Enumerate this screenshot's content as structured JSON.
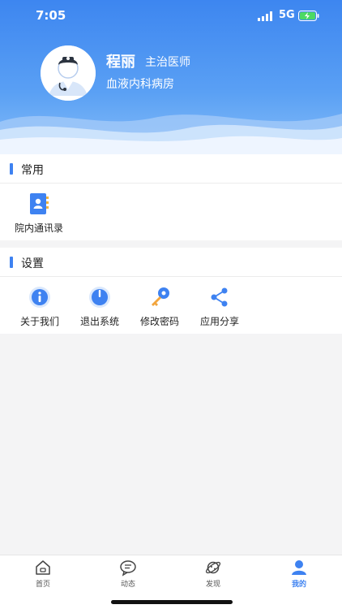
{
  "status_bar": {
    "time": "7:05",
    "network": "5G"
  },
  "profile": {
    "name": "程丽",
    "title": "主治医师",
    "department": "血液内科病房"
  },
  "common_section": {
    "title": "常用",
    "items": [
      {
        "label": "院内通讯录",
        "icon": "address-book-icon"
      }
    ]
  },
  "settings_section": {
    "title": "设置",
    "items": [
      {
        "label": "关于我们",
        "icon": "info-icon"
      },
      {
        "label": "退出系统",
        "icon": "power-icon"
      },
      {
        "label": "修改密码",
        "icon": "key-icon"
      },
      {
        "label": "应用分享",
        "icon": "share-icon"
      }
    ]
  },
  "tabbar": {
    "tabs": [
      {
        "label": "首页",
        "icon": "home-icon"
      },
      {
        "label": "动态",
        "icon": "message-icon"
      },
      {
        "label": "发现",
        "icon": "planet-icon"
      },
      {
        "label": "我的",
        "icon": "profile-icon",
        "active": true
      }
    ]
  },
  "colors": {
    "accent": "#3e82f1",
    "header_top": "#3d86f0",
    "header_bottom": "#86bdf8"
  }
}
